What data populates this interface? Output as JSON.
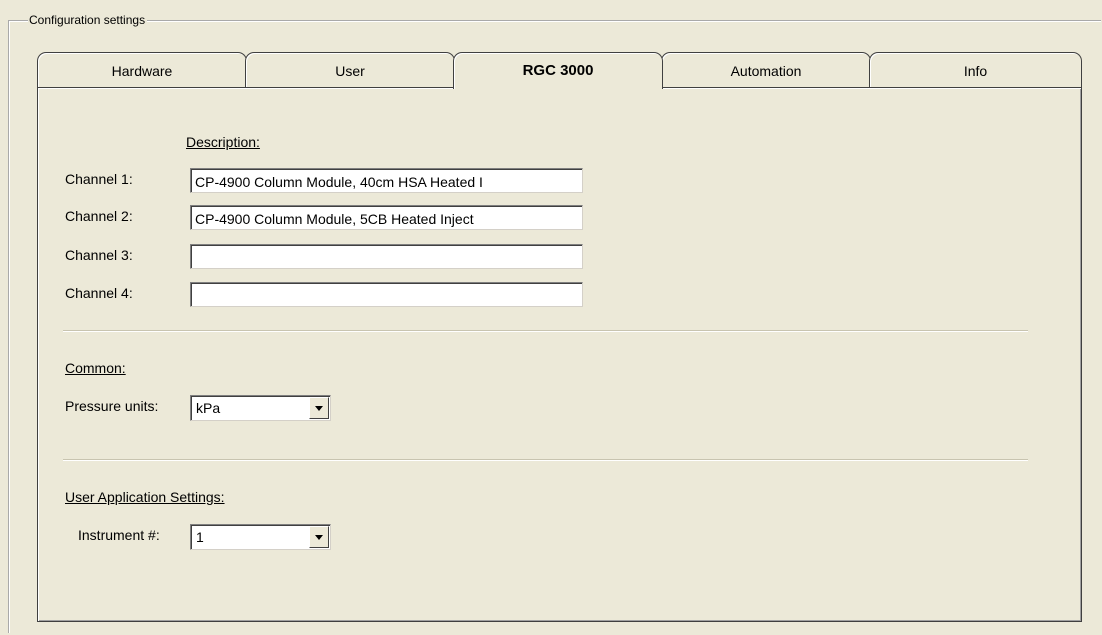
{
  "groupbox": {
    "title": "Configuration settings"
  },
  "tabs": [
    {
      "label": "Hardware",
      "active": false
    },
    {
      "label": "User",
      "active": false
    },
    {
      "label": "RGC 3000",
      "active": true
    },
    {
      "label": "Automation",
      "active": false
    },
    {
      "label": "Info",
      "active": false
    }
  ],
  "description_header": "Description:",
  "channels": [
    {
      "label": "Channel 1:",
      "value": "CP-4900 Column Module, 40cm HSA Heated I"
    },
    {
      "label": "Channel 2:",
      "value": "CP-4900 Column Module, 5CB Heated Inject"
    },
    {
      "label": "Channel 3:",
      "value": ""
    },
    {
      "label": "Channel 4:",
      "value": ""
    }
  ],
  "common": {
    "header": "Common:",
    "pressure_units_label": "Pressure units:",
    "pressure_units_value": "kPa"
  },
  "user_app": {
    "header": "User Application Settings:",
    "instrument_label": "Instrument #:",
    "instrument_value": "1"
  },
  "icons": {
    "dropdown": "chevron-down-icon"
  }
}
